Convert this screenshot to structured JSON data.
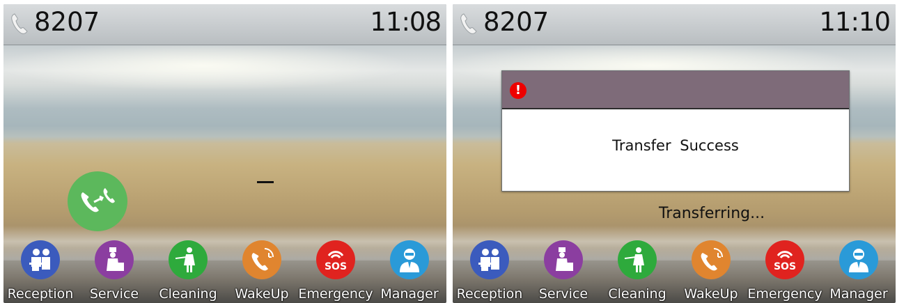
{
  "left_screen": {
    "status": {
      "extension": "8207",
      "time": "11:08",
      "icon": "phone-handset-icon"
    },
    "call_icon": "transfer-call-icon",
    "dash": "–"
  },
  "right_screen": {
    "status": {
      "extension": "8207",
      "time": "11:10",
      "icon": "phone-handset-icon"
    },
    "dialog": {
      "icon": "alert-icon",
      "icon_glyph": "!",
      "message": "Transfer  Success"
    },
    "status_text": "Transferring..."
  },
  "shortcuts": [
    {
      "label": "Reception",
      "icon": "reception-icon",
      "color": "#3b5bbd"
    },
    {
      "label": "Service",
      "icon": "service-icon",
      "color": "#8b3ea0"
    },
    {
      "label": "Cleaning",
      "icon": "cleaning-icon",
      "color": "#2eaa3c"
    },
    {
      "label": "WakeUp",
      "icon": "wakeup-icon",
      "color": "#e0852f"
    },
    {
      "label": "Emergency",
      "icon": "emergency-sos-icon",
      "color": "#e0231f"
    },
    {
      "label": "Manager",
      "icon": "manager-icon",
      "color": "#2a9ad8"
    }
  ],
  "colors": {
    "dialog_header": "#7e6b79",
    "call_green": "#5cb85c",
    "alert_red": "#e00000"
  }
}
